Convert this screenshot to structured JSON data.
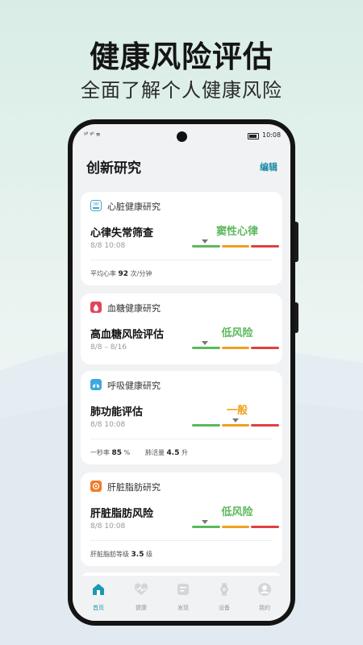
{
  "headline": {
    "title": "健康风险评估",
    "subtitle": "全面了解个人健康风险"
  },
  "status_bar": {
    "signal": "ᵍˡˡ ᵍˡˡ ≋",
    "time": "10:08"
  },
  "header": {
    "title": "创新研究",
    "edit_label": "编辑"
  },
  "colors": {
    "accent": "#1a8aa6",
    "good": "#5cb85c",
    "mid": "#f0a020",
    "bad": "#e04040"
  },
  "cards": [
    {
      "icon": "heart-study-icon",
      "title": "心脏健康研究",
      "test": "心律失常筛查",
      "date": "8/8 10:08",
      "result": "窦性心律",
      "level": 0.15,
      "metrics": [
        {
          "label": "平均心率",
          "value": "92",
          "unit": "次/分钟"
        }
      ]
    },
    {
      "icon": "blood-sugar-icon",
      "title": "血糖健康研究",
      "test": "高血糖风险评估",
      "date": "8/8 – 8/16",
      "result": "低风险",
      "level": 0.15,
      "metrics": []
    },
    {
      "icon": "lungs-icon",
      "title": "呼吸健康研究",
      "test": "肺功能评估",
      "date": "8/8 10:08",
      "result": "一般",
      "level": 0.5,
      "metrics": [
        {
          "label": "一秒率",
          "value": "85",
          "unit": "%"
        },
        {
          "label": "肺活量",
          "value": "4.5",
          "unit": "升"
        }
      ]
    },
    {
      "icon": "liver-icon",
      "title": "肝脏脂肪研究",
      "test": "肝脏脂肪风险",
      "date": "8/8 10:08",
      "result": "低风险",
      "level": 0.15,
      "metrics": [
        {
          "label": "肝脏脂肪等级",
          "value": "3.5",
          "unit": "级"
        }
      ]
    }
  ],
  "tabs": [
    {
      "label": "首页",
      "icon": "home-icon",
      "active": true
    },
    {
      "label": "健康",
      "icon": "heart-pulse-icon",
      "active": false
    },
    {
      "label": "发现",
      "icon": "discover-icon",
      "active": false
    },
    {
      "label": "设备",
      "icon": "watch-icon",
      "active": false
    },
    {
      "label": "我的",
      "icon": "user-icon",
      "active": false
    }
  ]
}
